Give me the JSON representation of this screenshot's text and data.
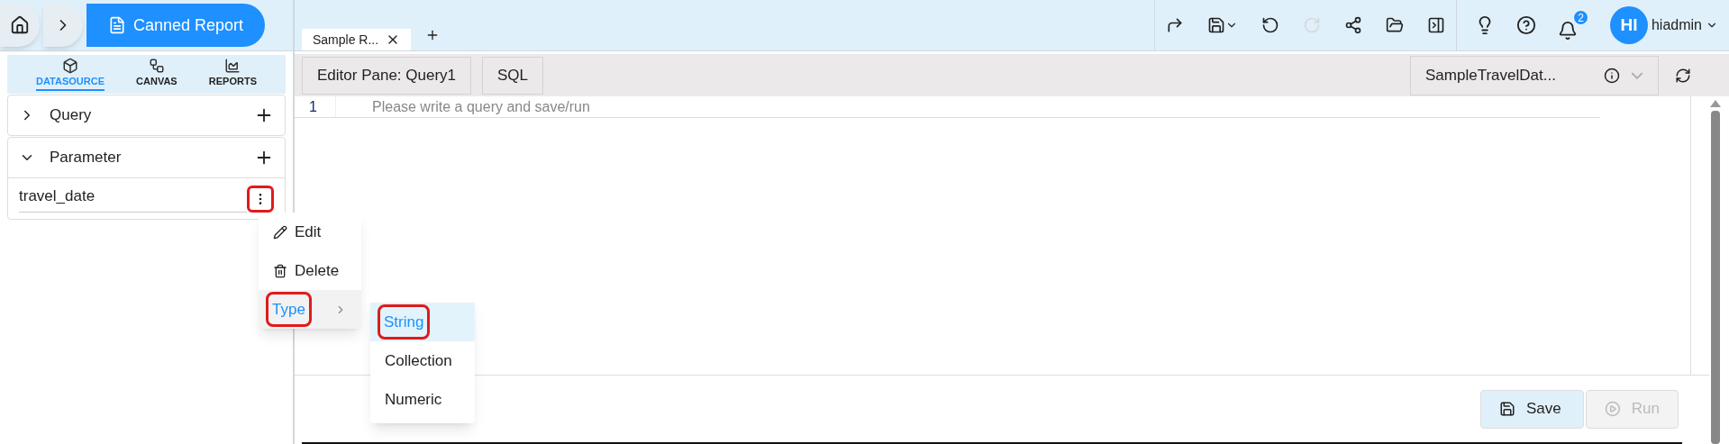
{
  "breadcrumb": {
    "title": "Canned Report"
  },
  "doc_tabs": [
    {
      "label": "Sample R...",
      "selected": true
    }
  ],
  "toolbar": [
    {
      "kind": "redo",
      "disabled": false
    },
    {
      "kind": "save",
      "disabled": false
    },
    {
      "kind": "undo",
      "disabled": false
    },
    {
      "kind": "refresh",
      "disabled": true
    },
    {
      "kind": "share",
      "disabled": false
    },
    {
      "kind": "preview",
      "disabled": false
    },
    {
      "kind": "panel",
      "disabled": false
    }
  ],
  "notifications": {
    "count": "2"
  },
  "user": {
    "initials": "HI",
    "name": "hiadmin"
  },
  "side_tabs": [
    {
      "label": "DATASOURCE",
      "kind": "datasource",
      "selected": true
    },
    {
      "label": "CANVAS",
      "kind": "canvas",
      "selected": false
    },
    {
      "label": "REPORTS",
      "kind": "reports",
      "selected": false
    }
  ],
  "sections": [
    {
      "label": "Query",
      "expanded": false
    },
    {
      "label": "Parameter",
      "expanded": true,
      "items": [
        "travel_date"
      ]
    }
  ],
  "context_menu": [
    {
      "label": "Edit",
      "kind": "edit",
      "selected": false
    },
    {
      "label": "Delete",
      "kind": "delete",
      "selected": false
    },
    {
      "label": "Type",
      "kind": "submenu",
      "selected": true
    }
  ],
  "submenu": [
    {
      "label": "String",
      "selected": true
    },
    {
      "label": "Collection",
      "selected": false
    },
    {
      "label": "Numeric",
      "selected": false
    }
  ],
  "editor": {
    "pane_label": "Editor Pane: Query1",
    "language": "SQL",
    "datasource": "SampleTravelDat...",
    "line_number": "1",
    "placeholder": "Please write a query and save/run"
  },
  "actions": [
    {
      "label": "Save",
      "kind": "save",
      "disabled": false
    },
    {
      "label": "Run",
      "kind": "run",
      "disabled": true
    }
  ]
}
